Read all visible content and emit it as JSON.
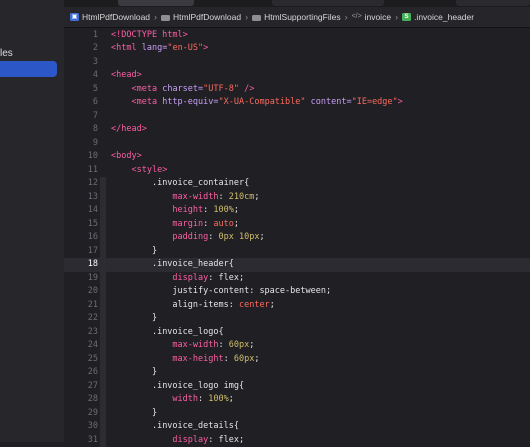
{
  "sidebar": {
    "visible_label": "les"
  },
  "breadcrumb": [
    {
      "label": "HtmlPdfDownload",
      "icon": "app-icon"
    },
    {
      "label": "HtmlPdfDownload",
      "icon": "folder-icon"
    },
    {
      "label": "HtmlSupportingFiles",
      "icon": "folder-icon"
    },
    {
      "label": "invoice",
      "icon": "code-tag-icon"
    },
    {
      "label": ".invoice_header",
      "icon": "style-selector-icon",
      "icon_glyph": "S"
    }
  ],
  "editor": {
    "current_line": 18,
    "lines": [
      {
        "n": "1",
        "tokens": [
          {
            "t": "<!DOCTYPE html>",
            "c": "tag"
          }
        ]
      },
      {
        "n": "2",
        "tokens": [
          {
            "t": "<html ",
            "c": "tag"
          },
          {
            "t": "lang",
            "c": "attr"
          },
          {
            "t": "=",
            "c": "attr"
          },
          {
            "t": "\"en-US\"",
            "c": "str"
          },
          {
            "t": ">",
            "c": "tag"
          }
        ]
      },
      {
        "n": "3",
        "tokens": []
      },
      {
        "n": "4",
        "tokens": [
          {
            "t": "<head>",
            "c": "tag"
          }
        ]
      },
      {
        "n": "5",
        "tokens": [
          {
            "t": "    "
          },
          {
            "t": "<meta ",
            "c": "tag"
          },
          {
            "t": "charset",
            "c": "attr"
          },
          {
            "t": "=",
            "c": "attr"
          },
          {
            "t": "\"UTF-8\"",
            "c": "str"
          },
          {
            "t": " />",
            "c": "tag"
          }
        ]
      },
      {
        "n": "6",
        "tokens": [
          {
            "t": "    "
          },
          {
            "t": "<meta ",
            "c": "tag"
          },
          {
            "t": "http-equiv",
            "c": "attr"
          },
          {
            "t": "=",
            "c": "attr"
          },
          {
            "t": "\"X-UA-Compatible\"",
            "c": "str"
          },
          {
            "t": " "
          },
          {
            "t": "content",
            "c": "attr"
          },
          {
            "t": "=",
            "c": "attr"
          },
          {
            "t": "\"IE=edge\"",
            "c": "str"
          },
          {
            "t": ">",
            "c": "tag"
          }
        ]
      },
      {
        "n": "7",
        "tokens": []
      },
      {
        "n": "8",
        "tokens": [
          {
            "t": "</head>",
            "c": "tag"
          }
        ]
      },
      {
        "n": "9",
        "tokens": []
      },
      {
        "n": "10",
        "tokens": [
          {
            "t": "<body>",
            "c": "tag"
          }
        ]
      },
      {
        "n": "11",
        "tokens": [
          {
            "t": "    "
          },
          {
            "t": "<style>",
            "c": "tag"
          }
        ]
      },
      {
        "n": "12",
        "tokens": [
          {
            "t": "        "
          },
          {
            "t": ".invoice_container{",
            "c": "sel"
          }
        ]
      },
      {
        "n": "13",
        "tokens": [
          {
            "t": "            "
          },
          {
            "t": "max-width",
            "c": "prop"
          },
          {
            "t": ": ",
            "c": "punct"
          },
          {
            "t": "210cm",
            "c": "num"
          },
          {
            "t": ";",
            "c": "punct"
          }
        ]
      },
      {
        "n": "14",
        "tokens": [
          {
            "t": "            "
          },
          {
            "t": "height",
            "c": "prop"
          },
          {
            "t": ": ",
            "c": "punct"
          },
          {
            "t": "100%",
            "c": "num"
          },
          {
            "t": ";",
            "c": "punct"
          }
        ]
      },
      {
        "n": "15",
        "tokens": [
          {
            "t": "            "
          },
          {
            "t": "margin",
            "c": "prop"
          },
          {
            "t": ": ",
            "c": "punct"
          },
          {
            "t": "auto",
            "c": "val"
          },
          {
            "t": ";",
            "c": "punct"
          }
        ]
      },
      {
        "n": "16",
        "tokens": [
          {
            "t": "            "
          },
          {
            "t": "padding",
            "c": "prop"
          },
          {
            "t": ": ",
            "c": "punct"
          },
          {
            "t": "0px 10px",
            "c": "num"
          },
          {
            "t": ";",
            "c": "punct"
          }
        ]
      },
      {
        "n": "17",
        "tokens": [
          {
            "t": "        "
          },
          {
            "t": "}",
            "c": "punct"
          }
        ]
      },
      {
        "n": "18",
        "tokens": [
          {
            "t": "        "
          },
          {
            "t": ".invoice_header{",
            "c": "sel"
          }
        ]
      },
      {
        "n": "19",
        "tokens": [
          {
            "t": "            "
          },
          {
            "t": "display",
            "c": "prop"
          },
          {
            "t": ": ",
            "c": "punct"
          },
          {
            "t": "flex",
            "c": "pval"
          },
          {
            "t": ";",
            "c": "punct"
          }
        ]
      },
      {
        "n": "20",
        "tokens": [
          {
            "t": "            "
          },
          {
            "t": "justify-content",
            "c": "pval"
          },
          {
            "t": ": ",
            "c": "punct"
          },
          {
            "t": "space-between",
            "c": "pval"
          },
          {
            "t": ";",
            "c": "punct"
          }
        ]
      },
      {
        "n": "21",
        "tokens": [
          {
            "t": "            "
          },
          {
            "t": "align-items",
            "c": "pval"
          },
          {
            "t": ": ",
            "c": "punct"
          },
          {
            "t": "center",
            "c": "val"
          },
          {
            "t": ";",
            "c": "punct"
          }
        ]
      },
      {
        "n": "22",
        "tokens": [
          {
            "t": "        "
          },
          {
            "t": "}",
            "c": "punct"
          }
        ]
      },
      {
        "n": "23",
        "tokens": [
          {
            "t": "        "
          },
          {
            "t": ".invoice_logo{",
            "c": "sel"
          }
        ]
      },
      {
        "n": "24",
        "tokens": [
          {
            "t": "            "
          },
          {
            "t": "max-width",
            "c": "prop"
          },
          {
            "t": ": ",
            "c": "punct"
          },
          {
            "t": "60px",
            "c": "num"
          },
          {
            "t": ";",
            "c": "punct"
          }
        ]
      },
      {
        "n": "25",
        "tokens": [
          {
            "t": "            "
          },
          {
            "t": "max-height",
            "c": "prop"
          },
          {
            "t": ": ",
            "c": "punct"
          },
          {
            "t": "60px",
            "c": "num"
          },
          {
            "t": ";",
            "c": "punct"
          }
        ]
      },
      {
        "n": "26",
        "tokens": [
          {
            "t": "        "
          },
          {
            "t": "}",
            "c": "punct"
          }
        ]
      },
      {
        "n": "27",
        "tokens": [
          {
            "t": "        "
          },
          {
            "t": ".invoice_logo img{",
            "c": "sel"
          }
        ]
      },
      {
        "n": "28",
        "tokens": [
          {
            "t": "            "
          },
          {
            "t": "width",
            "c": "prop"
          },
          {
            "t": ": ",
            "c": "punct"
          },
          {
            "t": "100%",
            "c": "num"
          },
          {
            "t": ";",
            "c": "punct"
          }
        ]
      },
      {
        "n": "29",
        "tokens": [
          {
            "t": "        "
          },
          {
            "t": "}",
            "c": "punct"
          }
        ]
      },
      {
        "n": "30",
        "tokens": [
          {
            "t": "        "
          },
          {
            "t": ".invoice_details{",
            "c": "sel"
          }
        ]
      },
      {
        "n": "31",
        "tokens": [
          {
            "t": "            "
          },
          {
            "t": "display",
            "c": "prop"
          },
          {
            "t": ": ",
            "c": "punct"
          },
          {
            "t": "flex",
            "c": "pval"
          },
          {
            "t": ";",
            "c": "punct"
          }
        ]
      }
    ]
  }
}
